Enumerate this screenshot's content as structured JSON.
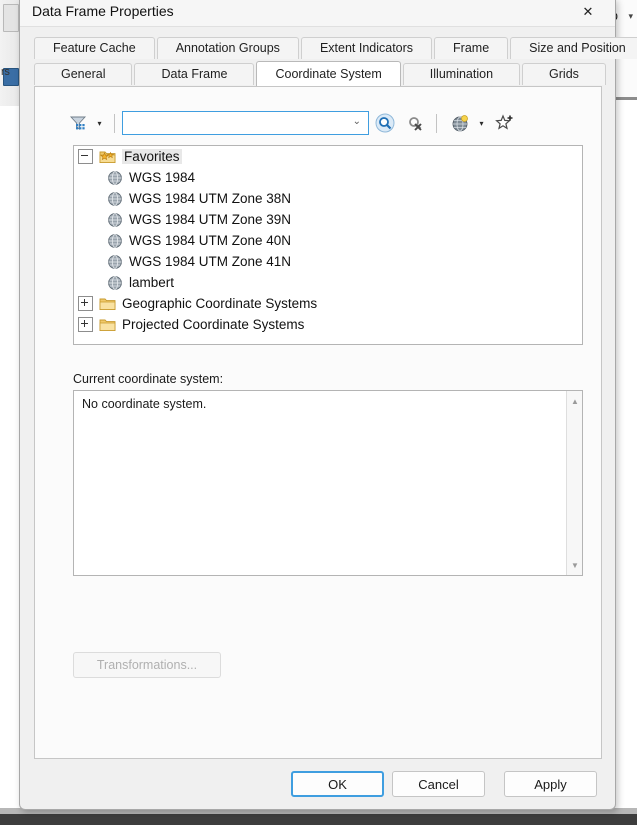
{
  "background": {
    "right_label": "p",
    "right_caret": "▾",
    "left_label": "rs"
  },
  "dialog": {
    "title": "Data Frame Properties",
    "close_icon": "✕"
  },
  "tabs": {
    "row1": [
      {
        "label": "Feature Cache",
        "active": false
      },
      {
        "label": "Annotation Groups",
        "active": false
      },
      {
        "label": "Extent Indicators",
        "active": false
      },
      {
        "label": "Frame",
        "active": false
      },
      {
        "label": "Size and Position",
        "active": false
      }
    ],
    "row2": [
      {
        "label": "General",
        "active": false
      },
      {
        "label": "Data Frame",
        "active": false
      },
      {
        "label": "Coordinate System",
        "active": true
      },
      {
        "label": "Illumination",
        "active": false
      },
      {
        "label": "Grids",
        "active": false
      }
    ]
  },
  "toolbar": {
    "filter_icon": "filter-icon",
    "filter_caret": "▾",
    "search_value": "",
    "search_placeholder": "",
    "combo_caret": "⌄",
    "search_icon": "search-icon",
    "clear_search_icon": "clear-search-icon",
    "globe_icon": "globe-icon",
    "globe_caret": "▾",
    "favorites_icon": "add-to-favorites-star-icon"
  },
  "tree": [
    {
      "label": "Favorites",
      "icon": "favorites-folder-icon",
      "level": 0,
      "expander": "minus",
      "selected": true
    },
    {
      "label": "WGS 1984",
      "icon": "globe-icon",
      "level": 1,
      "expander": "none",
      "selected": false
    },
    {
      "label": "WGS 1984 UTM Zone 38N",
      "icon": "globe-icon",
      "level": 1,
      "expander": "none",
      "selected": false
    },
    {
      "label": "WGS 1984 UTM Zone 39N",
      "icon": "globe-icon",
      "level": 1,
      "expander": "none",
      "selected": false
    },
    {
      "label": "WGS 1984 UTM Zone 40N",
      "icon": "globe-icon",
      "level": 1,
      "expander": "none",
      "selected": false
    },
    {
      "label": "WGS 1984 UTM Zone 41N",
      "icon": "globe-icon",
      "level": 1,
      "expander": "none",
      "selected": false
    },
    {
      "label": "lambert",
      "icon": "globe-icon",
      "level": 1,
      "expander": "none",
      "selected": false
    },
    {
      "label": "Geographic Coordinate Systems",
      "icon": "folder-icon",
      "level": 0,
      "expander": "plus",
      "selected": false
    },
    {
      "label": "Projected Coordinate Systems",
      "icon": "folder-icon",
      "level": 0,
      "expander": "plus",
      "selected": false
    }
  ],
  "current_coordinate_system": {
    "label": "Current coordinate system:",
    "value": "No coordinate system.",
    "scroll_up": "▲",
    "scroll_down": "▼"
  },
  "transformations": {
    "label": "Transformations..."
  },
  "footer": {
    "ok": "OK",
    "cancel": "Cancel",
    "apply": "Apply"
  },
  "colors": {
    "accent": "#3f9ee0",
    "dialog_bg": "#f0f0f0",
    "panel_bg": "#ffffff"
  }
}
